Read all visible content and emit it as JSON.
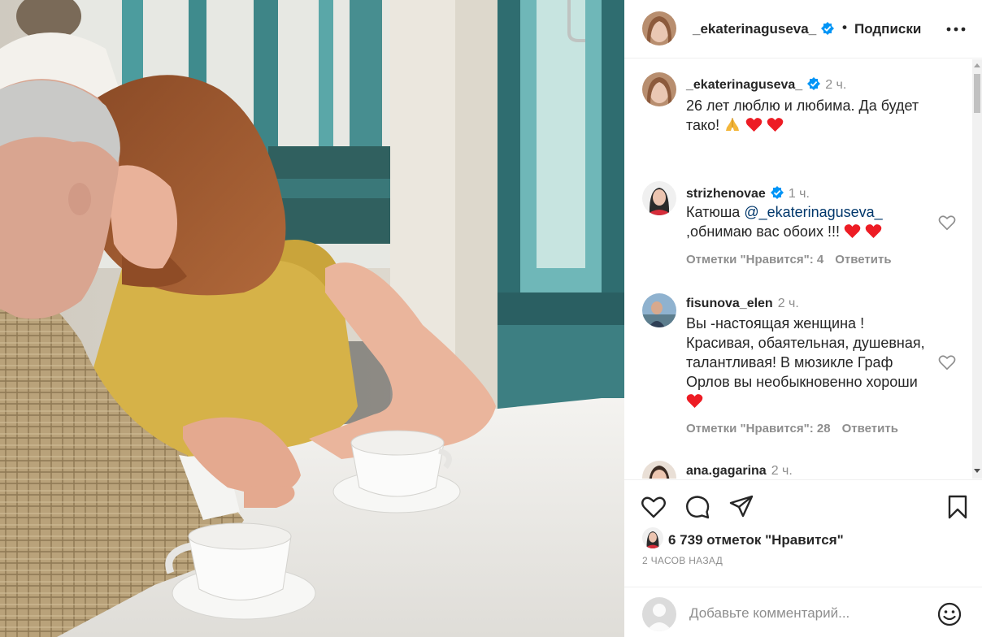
{
  "header": {
    "username": "_ekaterinaguseva_",
    "separator": "•",
    "follow_label": "Подписки",
    "more_label": "•••"
  },
  "comments": [
    {
      "username": "_ekaterinaguseva_",
      "verified": true,
      "time": "2 ч.",
      "text_line1": "26 лет люблю и любима. Да будет",
      "text_line2": "тако!"
    },
    {
      "username": "strizhenovae",
      "verified": true,
      "time": "1 ч.",
      "text_line1": "Катюша",
      "mention": "@_ekaterinaguseva_",
      "text_line2": ",обнимаю вас обоих !!!",
      "likes_label": "Отметки \"Нравится\": 4",
      "reply_label": "Ответить"
    },
    {
      "username": "fisunova_elen",
      "verified": false,
      "time": "2 ч.",
      "text_line1": "Вы -настоящая женщина !",
      "text_line2": "Красивая, обаятельная, душевная,",
      "text_line3": "талантливая! В мюзикле Граф",
      "text_line4": "Орлов вы необыкновенно хороши",
      "likes_label": "Отметки \"Нравится\": 28",
      "reply_label": "Ответить"
    },
    {
      "username": "ana.gagarina",
      "verified": false,
      "time": "2 ч."
    }
  ],
  "actions": {
    "likes_count": "6 739 отметок \"Нравится\"",
    "post_time": "2 ЧАСОВ НАЗАД"
  },
  "add_comment": {
    "placeholder": "Добавьте комментарий..."
  },
  "icons": {
    "verified": "verified-badge-icon",
    "like": "heart-outline-icon",
    "comment": "speech-bubble-icon",
    "share": "paper-plane-icon",
    "save": "bookmark-icon",
    "emoji": "smiley-icon"
  },
  "colors": {
    "verified_blue": "#0095f6",
    "heart_red": "#ed1c24",
    "mention_blue": "#00376b",
    "muted_text": "#8e8e8e"
  }
}
